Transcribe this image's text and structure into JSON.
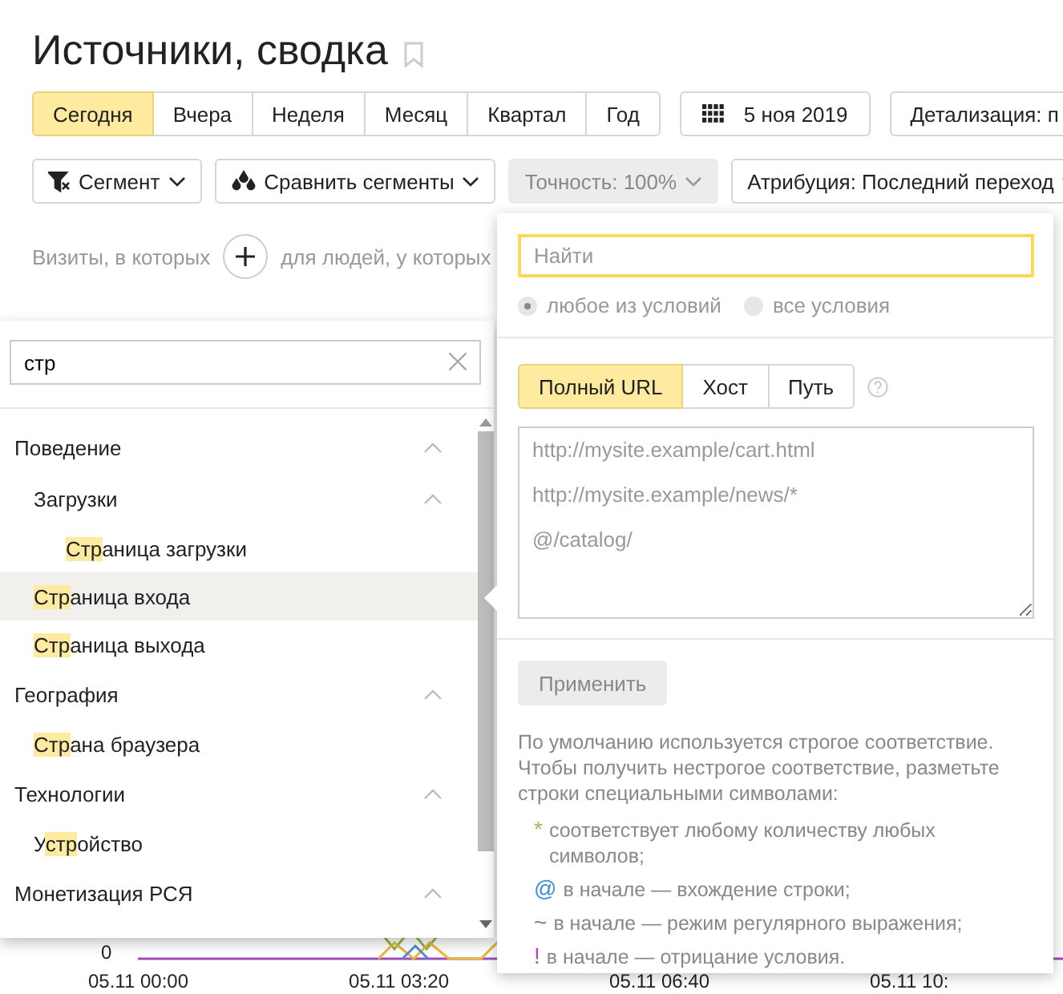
{
  "title": "Источники, сводка",
  "periods": [
    {
      "label": "Сегодня",
      "selected": true
    },
    {
      "label": "Вчера",
      "selected": false
    },
    {
      "label": "Неделя",
      "selected": false
    },
    {
      "label": "Месяц",
      "selected": false
    },
    {
      "label": "Квартал",
      "selected": false
    },
    {
      "label": "Год",
      "selected": false
    }
  ],
  "date_button": "5 ноя 2019",
  "detail_button": "Детализация: п",
  "filters": [
    {
      "label": "Сегмент",
      "kind": "segment",
      "disabled": false
    },
    {
      "label": "Сравнить сегменты",
      "kind": "compare",
      "disabled": false
    },
    {
      "label": "Точность: 100%",
      "kind": "plain",
      "disabled": true
    },
    {
      "label": "Атрибуция: Последний переход",
      "kind": "plain",
      "disabled": false
    }
  ],
  "segment_line": {
    "left": "Визиты, в которых",
    "right": "для людей, у которых"
  },
  "chart": {
    "y_label": "0",
    "x_labels": [
      "05.11 00:00",
      "05.11 03:20",
      "05.11 06:40",
      "05.11 10:"
    ]
  },
  "attribute_panel": {
    "search_value": "стр",
    "tree": [
      {
        "label": "Поведение",
        "expanded": true,
        "children": [
          {
            "label": "Загрузки",
            "expanded": true,
            "children": [
              {
                "match": "Стр",
                "after": "аница загрузки",
                "selected": false
              }
            ]
          },
          {
            "match": "Стр",
            "after": "аница входа",
            "selected": true
          },
          {
            "match": "Стр",
            "after": "аница выхода",
            "selected": false
          }
        ]
      },
      {
        "label": "География",
        "expanded": true,
        "children": [
          {
            "match": "Стр",
            "after": "ана браузера",
            "selected": false
          }
        ]
      },
      {
        "label": "Технологии",
        "expanded": true,
        "children": [
          {
            "before": "У",
            "match": "стр",
            "after": "ойство",
            "selected": false
          }
        ]
      },
      {
        "label": "Монетизация РСЯ",
        "expanded": true
      }
    ]
  },
  "condition_popup": {
    "search_placeholder": "Найти",
    "match_modes": [
      {
        "label": "любое из условий",
        "selected": true
      },
      {
        "label": "все условия",
        "selected": false
      }
    ],
    "url_tabs": [
      {
        "label": "Полный URL",
        "selected": true
      },
      {
        "label": "Хост",
        "selected": false
      },
      {
        "label": "Путь",
        "selected": false
      }
    ],
    "values_placeholder": "http://mysite.example/cart.html\nhttp://mysite.example/news/*\n@/catalog/",
    "apply_button": "Применить",
    "help_text": "По умолчанию используется строгое соответствие. Чтобы получить нестрогое соответствие, разметьте строки специальными символами:",
    "rules": [
      {
        "symbol": "*",
        "text": "соответствует любому количеству любых символов;",
        "color": "#a8b85c"
      },
      {
        "symbol": "@",
        "text": "в начале — вхождение строки;",
        "color": "#3d8fd6"
      },
      {
        "symbol": "~",
        "text": "в начале — режим регулярного выражения;",
        "color": "#9a6aa0"
      },
      {
        "symbol": "!",
        "text": "в начале — отрицание условия.",
        "color": "#c03ad0"
      }
    ]
  }
}
